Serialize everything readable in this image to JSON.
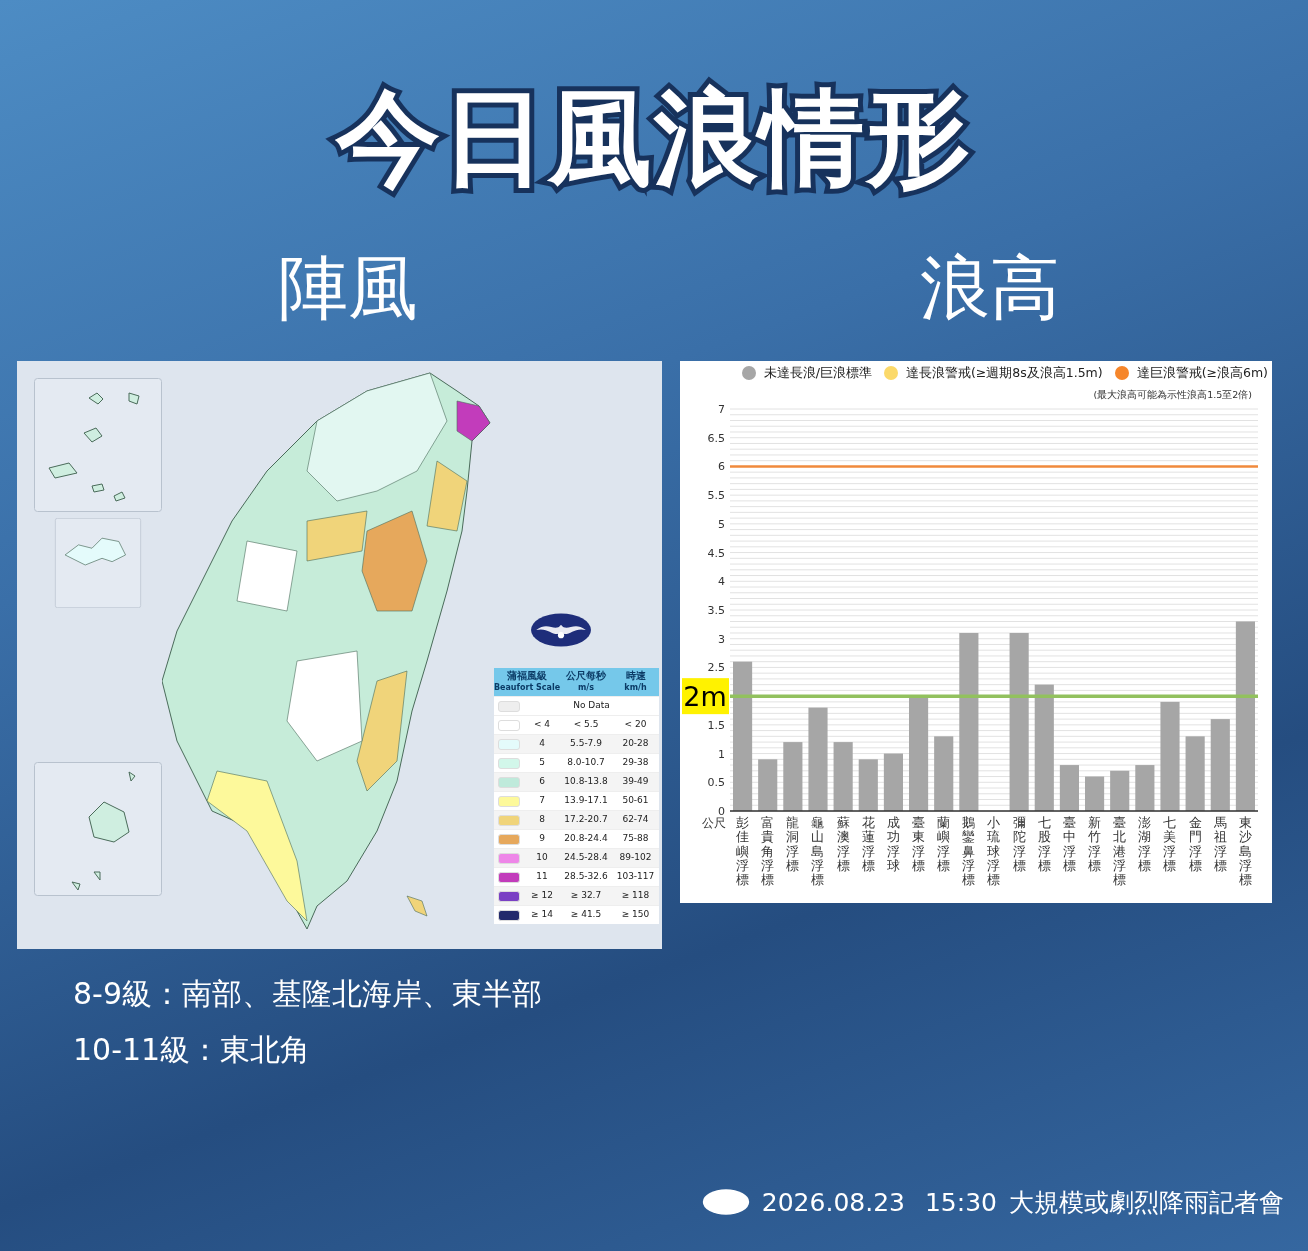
{
  "title": "今日風浪情形",
  "gust_panel": {
    "heading": "陣風",
    "legend": {
      "columns": [
        {
          "zh": "蒲福風級",
          "en": "Beaufort Scale"
        },
        {
          "zh": "公尺每秒",
          "en": "m/s"
        },
        {
          "zh": "時速",
          "en": "km/h"
        }
      ],
      "rows": [
        {
          "kind": "no_data",
          "color": "#eeeeee",
          "label": "No Data"
        },
        {
          "kind": "range",
          "color": "#ffffff",
          "scale": "< 4",
          "ms": "< 5.5",
          "kmh": "< 20"
        },
        {
          "kind": "range",
          "color": "#e4fbfb",
          "scale": "4",
          "ms": "5.5-7.9",
          "kmh": "20-28"
        },
        {
          "kind": "range",
          "color": "#d2f7ea",
          "scale": "5",
          "ms": "8.0-10.7",
          "kmh": "29-38"
        },
        {
          "kind": "range",
          "color": "#bfeadb",
          "scale": "6",
          "ms": "10.8-13.8",
          "kmh": "39-49"
        },
        {
          "kind": "range",
          "color": "#fdf99b",
          "scale": "7",
          "ms": "13.9-17.1",
          "kmh": "50-61"
        },
        {
          "kind": "range",
          "color": "#f0d47a",
          "scale": "8",
          "ms": "17.2-20.7",
          "kmh": "62-74"
        },
        {
          "kind": "range",
          "color": "#e6a85c",
          "scale": "9",
          "ms": "20.8-24.4",
          "kmh": "75-88"
        },
        {
          "kind": "range",
          "color": "#ee86e8",
          "scale": "10",
          "ms": "24.5-28.4",
          "kmh": "89-102"
        },
        {
          "kind": "range",
          "color": "#c23cbb",
          "scale": "11",
          "ms": "28.5-32.6",
          "kmh": "103-117"
        },
        {
          "kind": "range",
          "color": "#7a40c4",
          "scale": "≥ 12",
          "ms": "≥ 32.7",
          "kmh": "≥ 118"
        },
        {
          "kind": "range",
          "color": "#232a6c",
          "scale": "≥ 14",
          "ms": "≥ 41.5",
          "kmh": "≥ 150"
        }
      ]
    },
    "notes": [
      "8-9級：南部、基隆北海岸、東半部",
      "10-11級：東北角"
    ]
  },
  "wave_panel": {
    "heading": "浪高",
    "legend": [
      {
        "label": "達長浪警戒(≥週期8s及浪高1.5m)",
        "color": "#fbd96a"
      },
      {
        "label": "達巨浪警戒(≥浪高6m)",
        "color": "#f6862b"
      }
    ],
    "note": "(最大浪高可能為示性浪高1.5至2倍)",
    "unit": "公尺",
    "chart_data": {
      "type": "bar",
      "categories": [
        "彭佳嶼浮標",
        "富貴角浮標",
        "龍洞浮標",
        "龜山島浮標",
        "蘇澳浮標",
        "花蓮浮標",
        "成功浮球",
        "臺東浮標",
        "蘭嶼浮標",
        "鵝鑾鼻浮標",
        "小琉球浮標",
        "彌陀浮標",
        "七股浮標",
        "臺中浮標",
        "新竹浮標",
        "臺北港浮標",
        "澎湖浮標",
        "七美浮標",
        "金門浮標",
        "馬祖浮標",
        "東沙島浮標"
      ],
      "series": [
        {
          "name": "未達長浪/巨浪標準",
          "color": "#a6a6a6",
          "values": [
            2.6,
            0.9,
            1.2,
            1.8,
            1.2,
            0.9,
            1.0,
            2.0,
            1.3,
            3.1,
            null,
            3.1,
            2.2,
            0.8,
            0.6,
            0.7,
            0.8,
            1.9,
            1.3,
            1.6,
            3.3
          ]
        }
      ],
      "ylim": [
        0,
        7
      ],
      "yticks": [
        0,
        0.5,
        1,
        1.5,
        2.5,
        3,
        3.5,
        4,
        4.5,
        5,
        5.5,
        6,
        6.5,
        7
      ],
      "grid": true,
      "ref_lines": [
        {
          "axis": "y",
          "value": 6,
          "color": "#f08a3c"
        },
        {
          "axis": "y",
          "value": 2,
          "color": "#92c15e",
          "label": "2m"
        }
      ]
    }
  },
  "footer": {
    "date": "2026.08.23",
    "time": "15:30",
    "event": "大規模或劇烈降雨記者會"
  }
}
